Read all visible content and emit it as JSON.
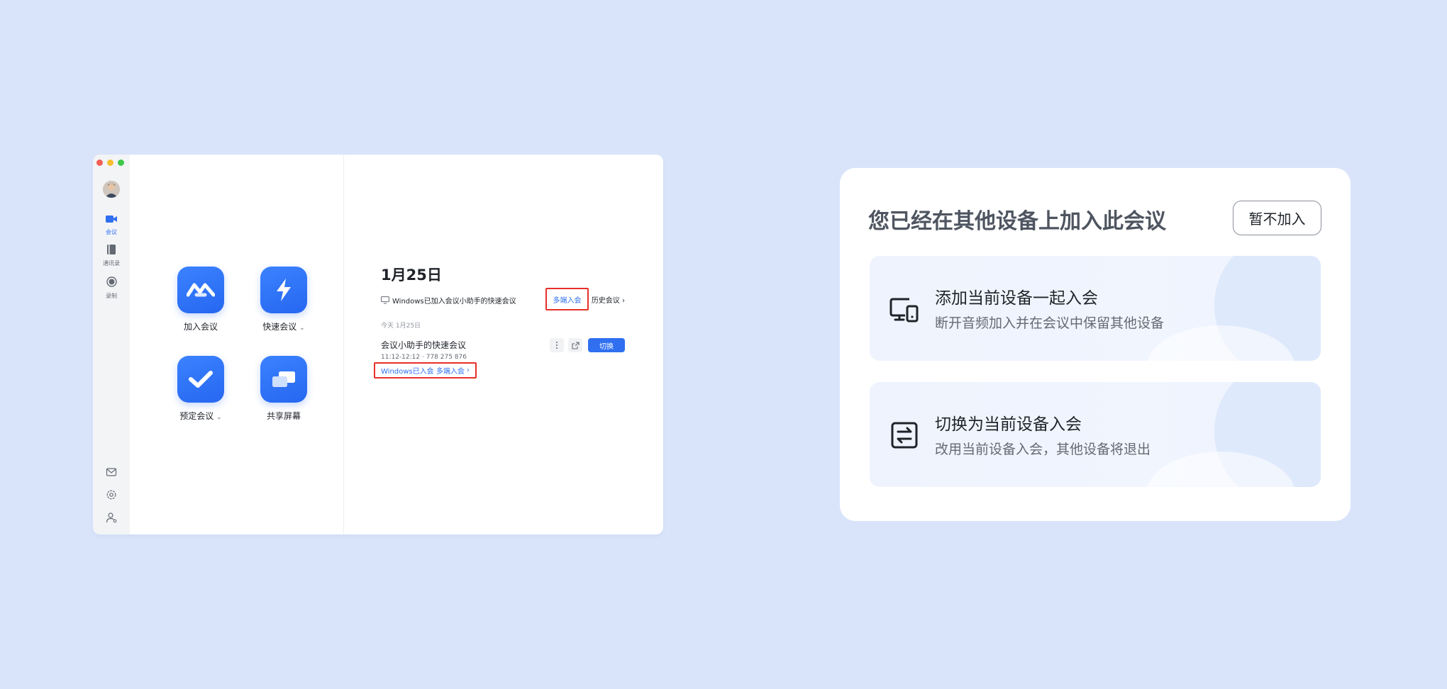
{
  "app": {
    "sidebar": {
      "items": [
        {
          "label": "会议",
          "icon": "video-camera-icon",
          "active": true
        },
        {
          "label": "通讯录",
          "icon": "contacts-book-icon",
          "active": false
        },
        {
          "label": "录制",
          "icon": "record-icon",
          "active": false
        }
      ],
      "bottom_icons": [
        "mail-icon",
        "settings-icon",
        "user-settings-icon"
      ]
    },
    "actions": [
      {
        "label": "加入会议",
        "icon": "join-meeting-icon"
      },
      {
        "label": "快速会议",
        "icon": "lightning-icon",
        "dropdown": true
      },
      {
        "label": "预定会议",
        "icon": "checkmark-icon",
        "dropdown": true
      },
      {
        "label": "共享屏幕",
        "icon": "share-screen-icon"
      }
    ],
    "main": {
      "date_title": "1月25日",
      "notice_text": "Windows已加入会议小助手的快速会议",
      "multi_join_label": "多端入会",
      "history_label": "历史会议",
      "today_label": "今天 1月25日",
      "meeting": {
        "title": "会议小助手的快速会议",
        "time_and_id": "11:12-12:12 · 778 275 876",
        "switch_label": "切换",
        "status_link": "Windows已入会 多端入会"
      }
    }
  },
  "dialog": {
    "title": "您已经在其他设备上加入此会议",
    "decline_label": "暂不加入",
    "options": [
      {
        "title": "添加当前设备一起入会",
        "subtitle": "断开音频加入并在会议中保留其他设备",
        "icon": "multi-device-icon"
      },
      {
        "title": "切换为当前设备入会",
        "subtitle": "改用当前设备入会，其他设备将退出",
        "icon": "switch-arrows-icon"
      }
    ]
  },
  "colors": {
    "background": "#d9e4fb",
    "accent": "#2f6ff0",
    "highlight_border": "#e8302a"
  }
}
